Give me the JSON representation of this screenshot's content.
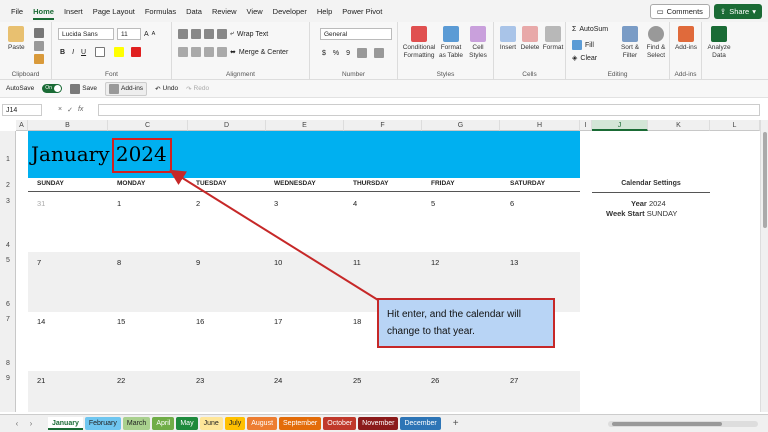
{
  "menu": {
    "tabs": [
      "File",
      "Home",
      "Insert",
      "Page Layout",
      "Formulas",
      "Data",
      "Review",
      "View",
      "Developer",
      "Help",
      "Power Pivot"
    ],
    "active": "Home",
    "comments_label": "Comments",
    "share_label": "Share"
  },
  "ribbon": {
    "clipboard": {
      "paste": "Paste",
      "label": "Clipboard"
    },
    "font": {
      "family": "Lucida Sans",
      "size": "11",
      "bold": "B",
      "italic": "I",
      "underline": "U",
      "grow": "A",
      "shrink": "A",
      "label": "Font"
    },
    "alignment": {
      "wrap": "Wrap Text",
      "merge": "Merge & Center",
      "label": "Alignment"
    },
    "number": {
      "format": "General",
      "currency": "$",
      "percent": "%",
      "comma": "9",
      "label": "Number"
    },
    "styles": {
      "conditional": "Conditional Formatting",
      "format_table": "Format as Table",
      "cell_styles": "Cell Styles",
      "label": "Styles"
    },
    "cells": {
      "insert": "Insert",
      "delete": "Delete",
      "format": "Format",
      "label": "Cells"
    },
    "editing": {
      "autosum": "AutoSum",
      "fill": "Fill",
      "clear": "Clear",
      "sort": "Sort & Filter",
      "find": "Find & Select",
      "label": "Editing"
    },
    "addins": {
      "addins": "Add-ins",
      "label": "Add-ins"
    },
    "analyze": {
      "label": "Analyze Data"
    }
  },
  "quickaccess": {
    "autosave": "AutoSave",
    "toggle": "On",
    "save": "Save",
    "addins": "Add-ins",
    "undo": "Undo",
    "redo": "Redo"
  },
  "formula": {
    "namebox": "J14",
    "cancel": "×",
    "enter": "✓",
    "fx": "fx"
  },
  "columns": [
    "A",
    "B",
    "C",
    "D",
    "E",
    "F",
    "G",
    "H",
    "I",
    "J",
    "K",
    "L"
  ],
  "rows": [
    "1",
    "2",
    "3",
    "4",
    "5",
    "6",
    "7",
    "8",
    "9"
  ],
  "calendar": {
    "month": "January",
    "year": "2024",
    "days": [
      "SUNDAY",
      "MONDAY",
      "TUESDAY",
      "WEDNESDAY",
      "THURSDAY",
      "FRIDAY",
      "SATURDAY"
    ],
    "weeks": [
      [
        "31",
        "1",
        "2",
        "3",
        "4",
        "5",
        "6"
      ],
      [
        "7",
        "8",
        "9",
        "10",
        "11",
        "12",
        "13"
      ],
      [
        "14",
        "15",
        "16",
        "17",
        "18",
        "",
        ""
      ],
      [
        "21",
        "22",
        "23",
        "24",
        "25",
        "26",
        "27"
      ]
    ]
  },
  "settings": {
    "title": "Calendar Settings",
    "year_label": "Year",
    "year_value": "2024",
    "week_label": "Week Start",
    "week_value": "SUNDAY"
  },
  "callout": {
    "text": "Hit enter, and the calendar will change to that year."
  },
  "sheets": [
    {
      "name": "January",
      "color": "#ffffff"
    },
    {
      "name": "February",
      "color": "#6fc6f0"
    },
    {
      "name": "March",
      "color": "#a9d08e"
    },
    {
      "name": "April",
      "color": "#70ad47"
    },
    {
      "name": "May",
      "color": "#1e8a3c"
    },
    {
      "name": "June",
      "color": "#ffe699"
    },
    {
      "name": "July",
      "color": "#ffc000"
    },
    {
      "name": "August",
      "color": "#ed7d31"
    },
    {
      "name": "September",
      "color": "#e36c09"
    },
    {
      "name": "October",
      "color": "#c0392b"
    },
    {
      "name": "November",
      "color": "#8b1a1a"
    },
    {
      "name": "December",
      "color": "#2e75b6"
    }
  ],
  "add_sheet": "+",
  "colors": {
    "accent": "#1a6b35",
    "banner": "#00b0f0",
    "highlight": "#d32020",
    "callout_bg": "#b8d4f5"
  }
}
